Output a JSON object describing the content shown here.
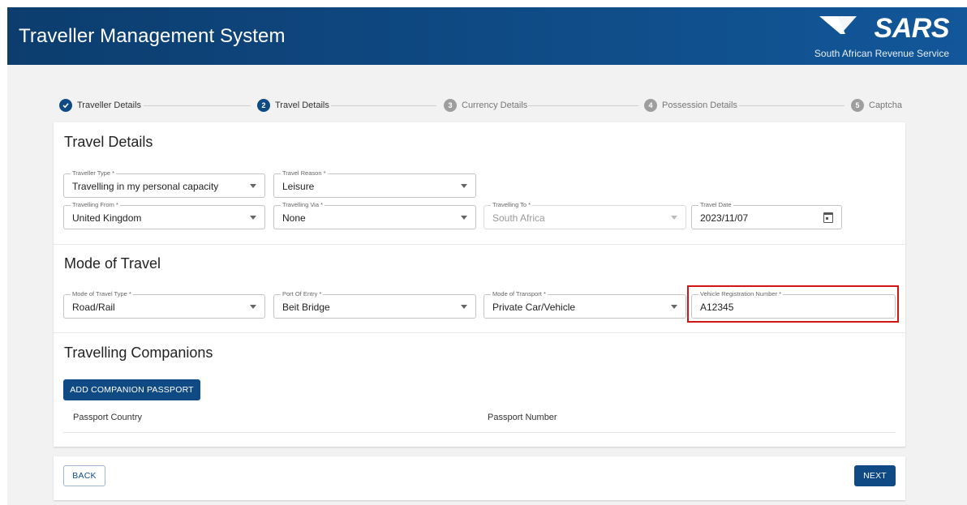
{
  "header": {
    "title": "Traveller Management System",
    "logo_text": "SARS",
    "logo_subtitle": "South African Revenue Service",
    "color": "#0f4a84"
  },
  "stepper": {
    "steps": [
      {
        "number": "1",
        "label": "Traveller Details",
        "state": "completed"
      },
      {
        "number": "2",
        "label": "Travel Details",
        "state": "active"
      },
      {
        "number": "3",
        "label": "Currency Details",
        "state": "pending"
      },
      {
        "number": "4",
        "label": "Possession Details",
        "state": "pending"
      },
      {
        "number": "5",
        "label": "Captcha",
        "state": "pending"
      }
    ]
  },
  "travel_details": {
    "title": "Travel Details",
    "traveller_type": {
      "label": "Traveller Type *",
      "value": "Travelling in my personal capacity"
    },
    "travel_reason": {
      "label": "Travel Reason *",
      "value": "Leisure"
    },
    "travelling_from": {
      "label": "Travelling From *",
      "value": "United Kingdom"
    },
    "travelling_via": {
      "label": "Travelling Via *",
      "value": "None"
    },
    "travelling_to": {
      "label": "Travelling To *",
      "value": "South Africa"
    },
    "travel_date": {
      "label": "Travel Date",
      "value": "2023/11/07"
    }
  },
  "mode_of_travel": {
    "title": "Mode of Travel",
    "mode_type": {
      "label": "Mode of Travel Type *",
      "value": "Road/Rail"
    },
    "port_of_entry": {
      "label": "Port Of Entry *",
      "value": "Beit Bridge"
    },
    "mode_of_transport": {
      "label": "Mode of Transport *",
      "value": "Private Car/Vehicle"
    },
    "vehicle_registration": {
      "label": "Vehicle Registration Number *",
      "value": "A12345"
    }
  },
  "companions": {
    "title": "Travelling Companions",
    "add_button": "ADD COMPANION PASSPORT",
    "columns": [
      "Passport Country",
      "Passport Number"
    ]
  },
  "footer": {
    "back_label": "BACK",
    "next_label": "NEXT"
  },
  "colors": {
    "accent": "#0f4a84",
    "highlight": "#d11414"
  }
}
